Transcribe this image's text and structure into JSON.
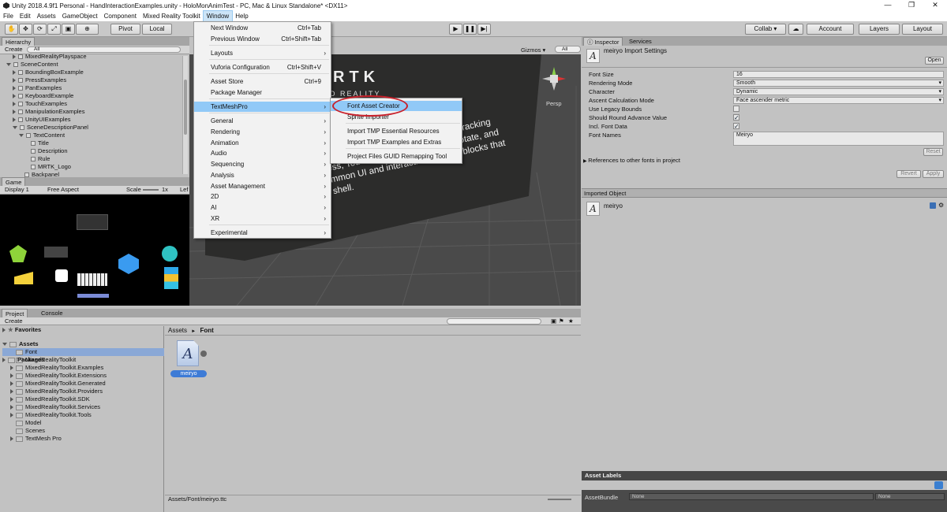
{
  "window": {
    "title": "Unity 2018.4.9f1 Personal - HandInteractionExamples.unity - HoloMonAnimTest - PC, Mac & Linux Standalone* <DX11>",
    "minimize": "—",
    "maximize": "❐",
    "close": "✕"
  },
  "menubar": [
    "File",
    "Edit",
    "Assets",
    "GameObject",
    "Component",
    "Mixed Reality Toolkit",
    "Window",
    "Help"
  ],
  "toolbar": {
    "pivot": "Pivot",
    "local": "Local",
    "collab": "Collab ▾",
    "account": "Account",
    "layers": "Layers",
    "layout": "Layout"
  },
  "hierarchy": {
    "tab": "Hierarchy",
    "create": "Create",
    "search": "All",
    "items": [
      {
        "label": "MixedRealityPlayspace",
        "indent": 1,
        "tri": "closed"
      },
      {
        "label": "SceneContent",
        "indent": 0,
        "tri": "open"
      },
      {
        "label": "BoundingBoxExample",
        "indent": 1,
        "tri": "closed"
      },
      {
        "label": "PressExamples",
        "indent": 1,
        "tri": "closed"
      },
      {
        "label": "PanExamples",
        "indent": 1,
        "tri": "closed"
      },
      {
        "label": "KeyboardExample",
        "indent": 1,
        "tri": "closed"
      },
      {
        "label": "TouchExamples",
        "indent": 1,
        "tri": "closed"
      },
      {
        "label": "ManipulationExamples",
        "indent": 1,
        "tri": "closed"
      },
      {
        "label": "UnityUIExamples",
        "indent": 1,
        "tri": "closed"
      },
      {
        "label": "SceneDescriptionPanel",
        "indent": 1,
        "tri": "open"
      },
      {
        "label": "TextContent",
        "indent": 2,
        "tri": "open"
      },
      {
        "label": "Title",
        "indent": 3,
        "tri": "none"
      },
      {
        "label": "Description",
        "indent": 3,
        "tri": "none"
      },
      {
        "label": "Rule",
        "indent": 3,
        "tri": "none"
      },
      {
        "label": "MRTK_Logo",
        "indent": 3,
        "tri": "none"
      },
      {
        "label": "Backpanel",
        "indent": 2,
        "tri": "none"
      }
    ]
  },
  "game": {
    "tab": "Game",
    "display": "Display 1",
    "aspect": "Free Aspect",
    "scale_label": "Scale",
    "scale_value": "1x",
    "lef": "Lef"
  },
  "scene": {
    "gizmos": "Gizmos ▾",
    "search": "All",
    "persp": "Persp",
    "logo_title": "RTK",
    "logo_sub": "D REALITY",
    "lines": [
      "e demonstrates various types of hand tracking",
      "s Press, Touch, Grab, Scroll, Move, Rotate, and",
      "d common UI and interaction building blocks that",
      "ens shell."
    ]
  },
  "window_menu": {
    "items": [
      {
        "label": "Next Window",
        "shortcut": "Ctrl+Tab"
      },
      {
        "label": "Previous Window",
        "shortcut": "Ctrl+Shift+Tab"
      },
      {
        "label": "Layouts",
        "arrow": "›"
      },
      {
        "label": "Vuforia Configuration",
        "shortcut": "Ctrl+Shift+V"
      },
      {
        "label": "Asset Store",
        "shortcut": "Ctrl+9"
      },
      {
        "label": "Package Manager"
      },
      {
        "label": "TextMeshPro",
        "arrow": "›"
      },
      {
        "label": "General",
        "arrow": "›"
      },
      {
        "label": "Rendering",
        "arrow": "›"
      },
      {
        "label": "Animation",
        "arrow": "›"
      },
      {
        "label": "Audio",
        "arrow": "›"
      },
      {
        "label": "Sequencing",
        "arrow": "›"
      },
      {
        "label": "Analysis",
        "arrow": "›"
      },
      {
        "label": "Asset Management",
        "arrow": "›"
      },
      {
        "label": "2D",
        "arrow": "›"
      },
      {
        "label": "AI",
        "arrow": "›"
      },
      {
        "label": "XR",
        "arrow": "›"
      },
      {
        "label": "Experimental",
        "arrow": "›"
      }
    ]
  },
  "tmp_menu": {
    "items": [
      {
        "label": "Font Asset Creator"
      },
      {
        "label": "Sprite Importer"
      },
      {
        "label": "Import TMP Essential Resources"
      },
      {
        "label": "Import TMP Examples and Extras"
      },
      {
        "label": "Project Files GUID Remapping Tool"
      }
    ]
  },
  "inspector": {
    "tab": "Inspector",
    "tab2": "Services",
    "title": "meiryo Import Settings",
    "open": "Open",
    "rows": [
      {
        "label": "Font Size",
        "value": "16",
        "kind": "field"
      },
      {
        "label": "Rendering Mode",
        "value": "Smooth",
        "kind": "dropdown"
      },
      {
        "label": "Character",
        "value": "Dynamic",
        "kind": "dropdown"
      },
      {
        "label": "Ascent Calculation Mode",
        "value": "Face ascender metric",
        "kind": "dropdown"
      },
      {
        "label": "Use Legacy Bounds",
        "value": "",
        "kind": "check"
      },
      {
        "label": "Should Round Advance Value",
        "value": "✓",
        "kind": "check"
      },
      {
        "label": "Incl. Font Data",
        "value": "✓",
        "kind": "check"
      },
      {
        "label": "Font Names",
        "value": "Meiryo",
        "kind": "text"
      }
    ],
    "reset": "Reset",
    "refs": "References to other fonts in project",
    "revert": "Revert",
    "apply": "Apply",
    "imported_header": "Imported Object",
    "imported_name": "meiryo",
    "asset_labels": "Asset Labels",
    "assetbundle": "AssetBundle",
    "none1": "None",
    "none2": "None"
  },
  "project": {
    "tab": "Project",
    "tab2": "Console",
    "create": "Create",
    "favorites": "Favorites",
    "assets": "Assets",
    "packages": "Packages",
    "folders": [
      "Font",
      "MixedRealityToolkit",
      "MixedRealityToolkit.Examples",
      "MixedRealityToolkit.Extensions",
      "MixedRealityToolkit.Generated",
      "MixedRealityToolkit.Providers",
      "MixedRealityToolkit.SDK",
      "MixedRealityToolkit.Services",
      "MixedRealityToolkit.Tools",
      "Model",
      "Scenes",
      "TextMesh Pro"
    ],
    "breadcrumb_root": "Assets",
    "breadcrumb_sep": "►",
    "breadcrumb_leaf": "Font",
    "file_label": "meiryo",
    "glyph": "A",
    "status_path": "Assets/Font/meiryo.ttc"
  },
  "colors": {
    "scene_bg": "#4a4a4a",
    "highlight": "#91c9f7",
    "selection": "#3d7bd6",
    "annotation": "#c8202a"
  }
}
